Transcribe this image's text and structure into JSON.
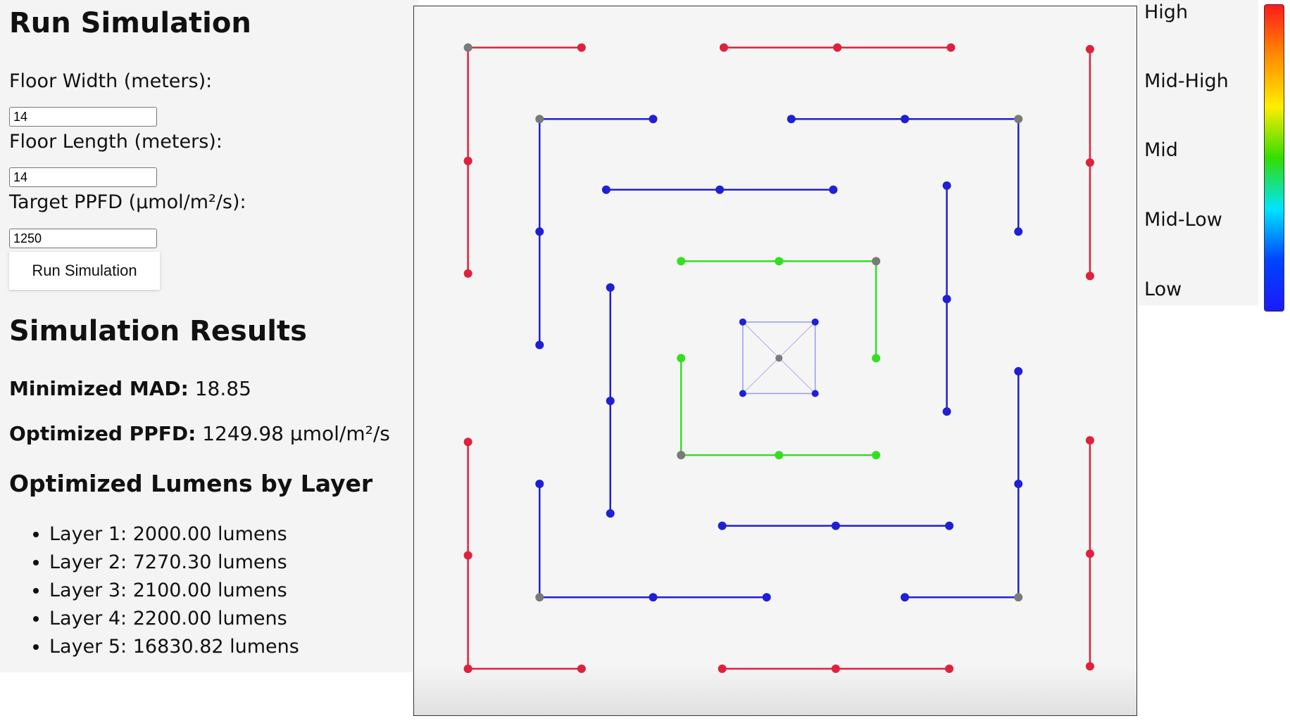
{
  "page": {
    "title": "Run Simulation",
    "fields": {
      "floor_width_label": "Floor Width (meters):",
      "floor_width_value": "14",
      "floor_length_label": "Floor Length (meters):",
      "floor_length_value": "14",
      "target_ppfd_label": "Target PPFD (µmol/m²/s):",
      "target_ppfd_value": "1250"
    },
    "run_button_label": "Run Simulation"
  },
  "results": {
    "heading": "Simulation Results",
    "mad_label": "Minimized MAD:",
    "mad_value": "18.85",
    "ppfd_label": "Optimized PPFD:",
    "ppfd_value": "1249.98 µmol/m²/s",
    "lumens_heading": "Optimized Lumens by Layer",
    "layers": [
      "Layer 1: 2000.00 lumens",
      "Layer 2: 7270.30 lumens",
      "Layer 3: 2100.00 lumens",
      "Layer 4: 2200.00 lumens",
      "Layer 5: 16830.82 lumens"
    ]
  },
  "legend": {
    "labels": [
      "High",
      "Mid-High",
      "Mid",
      "Mid-Low",
      "Low"
    ],
    "gradient_colors": [
      "#ff1a1a",
      "#ff8c00",
      "#ffee00",
      "#33dd00",
      "#00e5ff",
      "#0044ff",
      "#1a1aff"
    ]
  },
  "colors": {
    "red_layer": "#e0213c",
    "blue_layer": "#1f1fd6",
    "green_layer": "#33e020",
    "center_square": "#9999ee",
    "corner_node": "#7a7a7a"
  }
}
